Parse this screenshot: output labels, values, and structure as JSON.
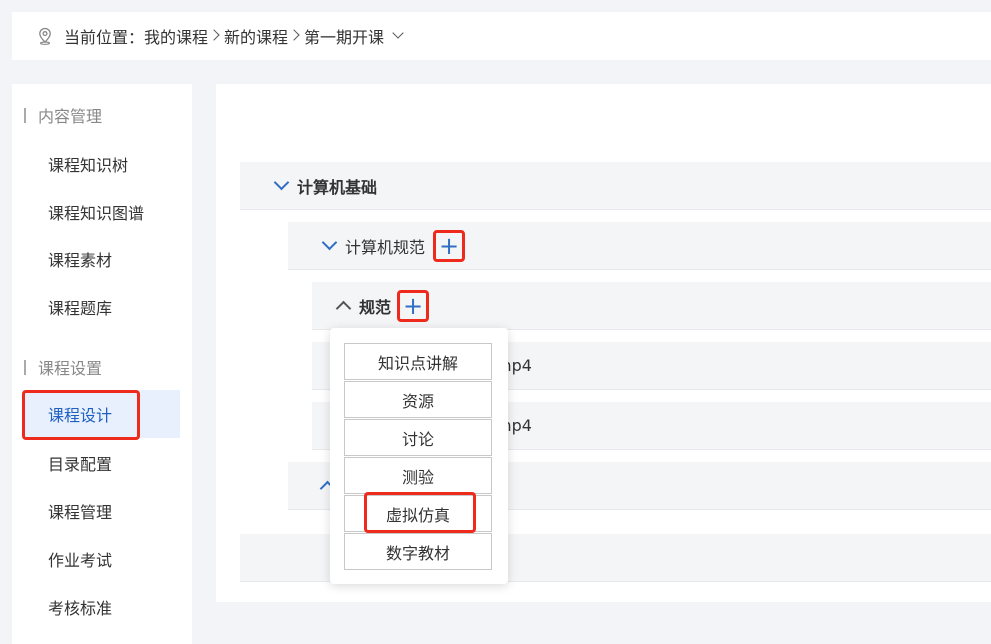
{
  "breadcrumb": {
    "prefix": "当前位置：",
    "items": [
      "我的课程",
      "新的课程",
      "第一期开课"
    ]
  },
  "sidebar": {
    "groups": [
      {
        "title": "内容管理",
        "items": [
          "课程知识树",
          "课程知识图谱",
          "课程素材",
          "课程题库"
        ]
      },
      {
        "title": "课程设置",
        "items": [
          "课程设计",
          "目录配置",
          "课程管理",
          "作业考试",
          "考核标准"
        ]
      }
    ],
    "active_item": "课程设计"
  },
  "tree": {
    "level1": "计算机基础",
    "level2": "计算机规范",
    "level3": "规范",
    "file1_suffix": "mp4",
    "file2_suffix": "mp4"
  },
  "add_menu": {
    "options": [
      "知识点讲解",
      "资源",
      "讨论",
      "测验",
      "虚拟仿真",
      "数字教材"
    ],
    "highlighted": "虚拟仿真"
  },
  "colors": {
    "accent": "#2f6ec4",
    "highlight_box": "#ee2a1c",
    "active_bg": "#e8f0fe"
  }
}
